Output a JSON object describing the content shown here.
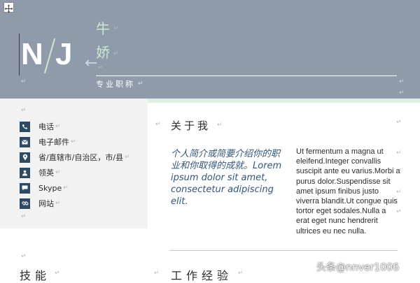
{
  "header": {
    "monogram_first": "N",
    "monogram_second": "J",
    "name_line1": "牛",
    "name_line2": "娇",
    "job_title": "专业职称",
    "paragraph_mark": "↵",
    "background_color": "#8f9aab",
    "accent_color": "#cde9d2"
  },
  "contact": {
    "items": [
      {
        "icon": "phone-icon",
        "label": "电话"
      },
      {
        "icon": "email-icon",
        "label": "电子邮件"
      },
      {
        "icon": "location-icon",
        "label": "省/直辖市/自治区，市/县"
      },
      {
        "icon": "linkedin-icon",
        "label": "领英"
      },
      {
        "icon": "skype-icon",
        "label": "Skype"
      },
      {
        "icon": "link-icon",
        "label": "网站"
      }
    ],
    "icon_color": "#2e4a63"
  },
  "about": {
    "heading": "关于我",
    "intro": "个人简介或简要介绍你的职业和你取得的成就。Lorem ipsum dolor sit amet, consectetur adipiscing elit.",
    "body": "Ut fermentum a magna ut eleifend.Integer convallis suscipit ante eu varius.Morbi a purus dolor.Suspendisse sit amet ipsum finibus justo viverra blandit.Ut congue quis tortor eget sodales.Nulla a erat eget nunc hendrerit ultrices eu nec nulla."
  },
  "sections": {
    "skills_heading": "技能",
    "work_heading": "工作经验"
  },
  "watermark": {
    "text": "头条@nnver1006"
  }
}
